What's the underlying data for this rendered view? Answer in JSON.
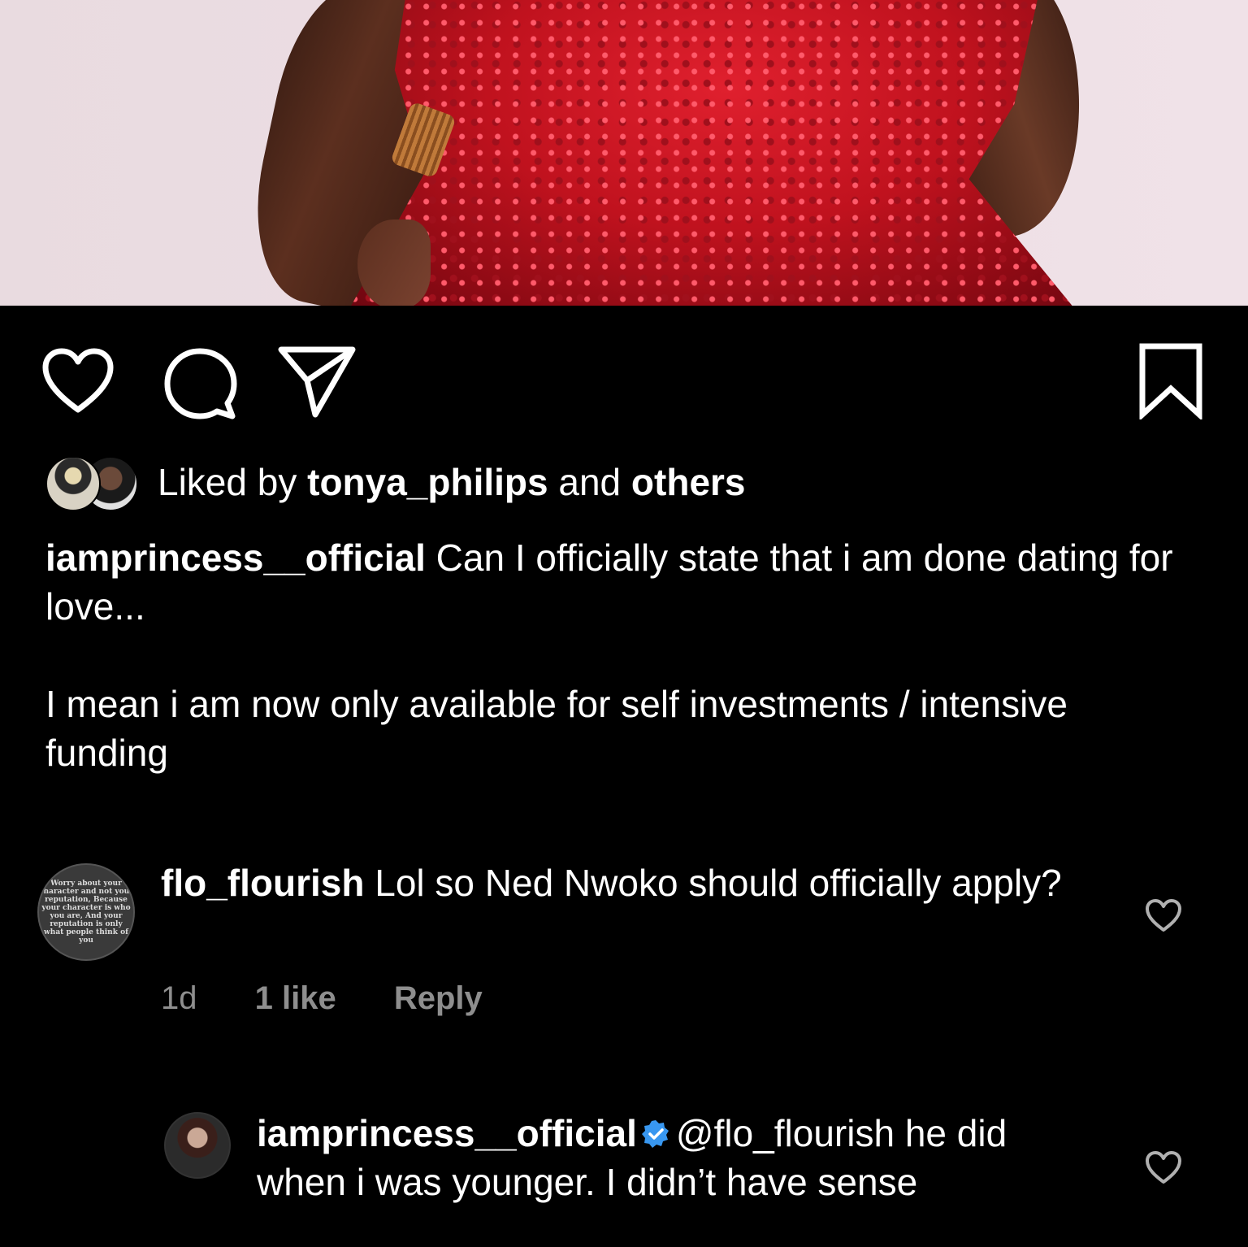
{
  "post": {
    "liked_by_prefix": "Liked by",
    "liked_by_user": "tonya_philips",
    "liked_by_and": "and",
    "liked_by_others": "others",
    "caption_user": "iamprincess__official",
    "caption_line1": "Can I officially state that i am done dating for love...",
    "caption_line2": "I mean i am now only available for self investments / intensive funding"
  },
  "comments": [
    {
      "user": "flo_flourish",
      "text": "Lol so Ned Nwoko should officially apply?",
      "avatar_text": "Worry about your character and not your reputation, Because your character is who you are, And your reputation is only what people think of you",
      "time": "1d",
      "likes": "1 like",
      "reply": "Reply"
    },
    {
      "user": "iamprincess__official",
      "verified": true,
      "mention": "@flo_flourish",
      "text": "he did when i was younger. I didn’t have sense"
    }
  ],
  "icons": {
    "like": "heart-icon",
    "comment": "comment-bubble-icon",
    "share": "paper-plane-icon",
    "save": "bookmark-icon",
    "verified": "verified-badge-icon"
  },
  "colors": {
    "background": "#000000",
    "text": "#ffffff",
    "muted": "#8e8e8e",
    "verified": "#3897f0"
  }
}
